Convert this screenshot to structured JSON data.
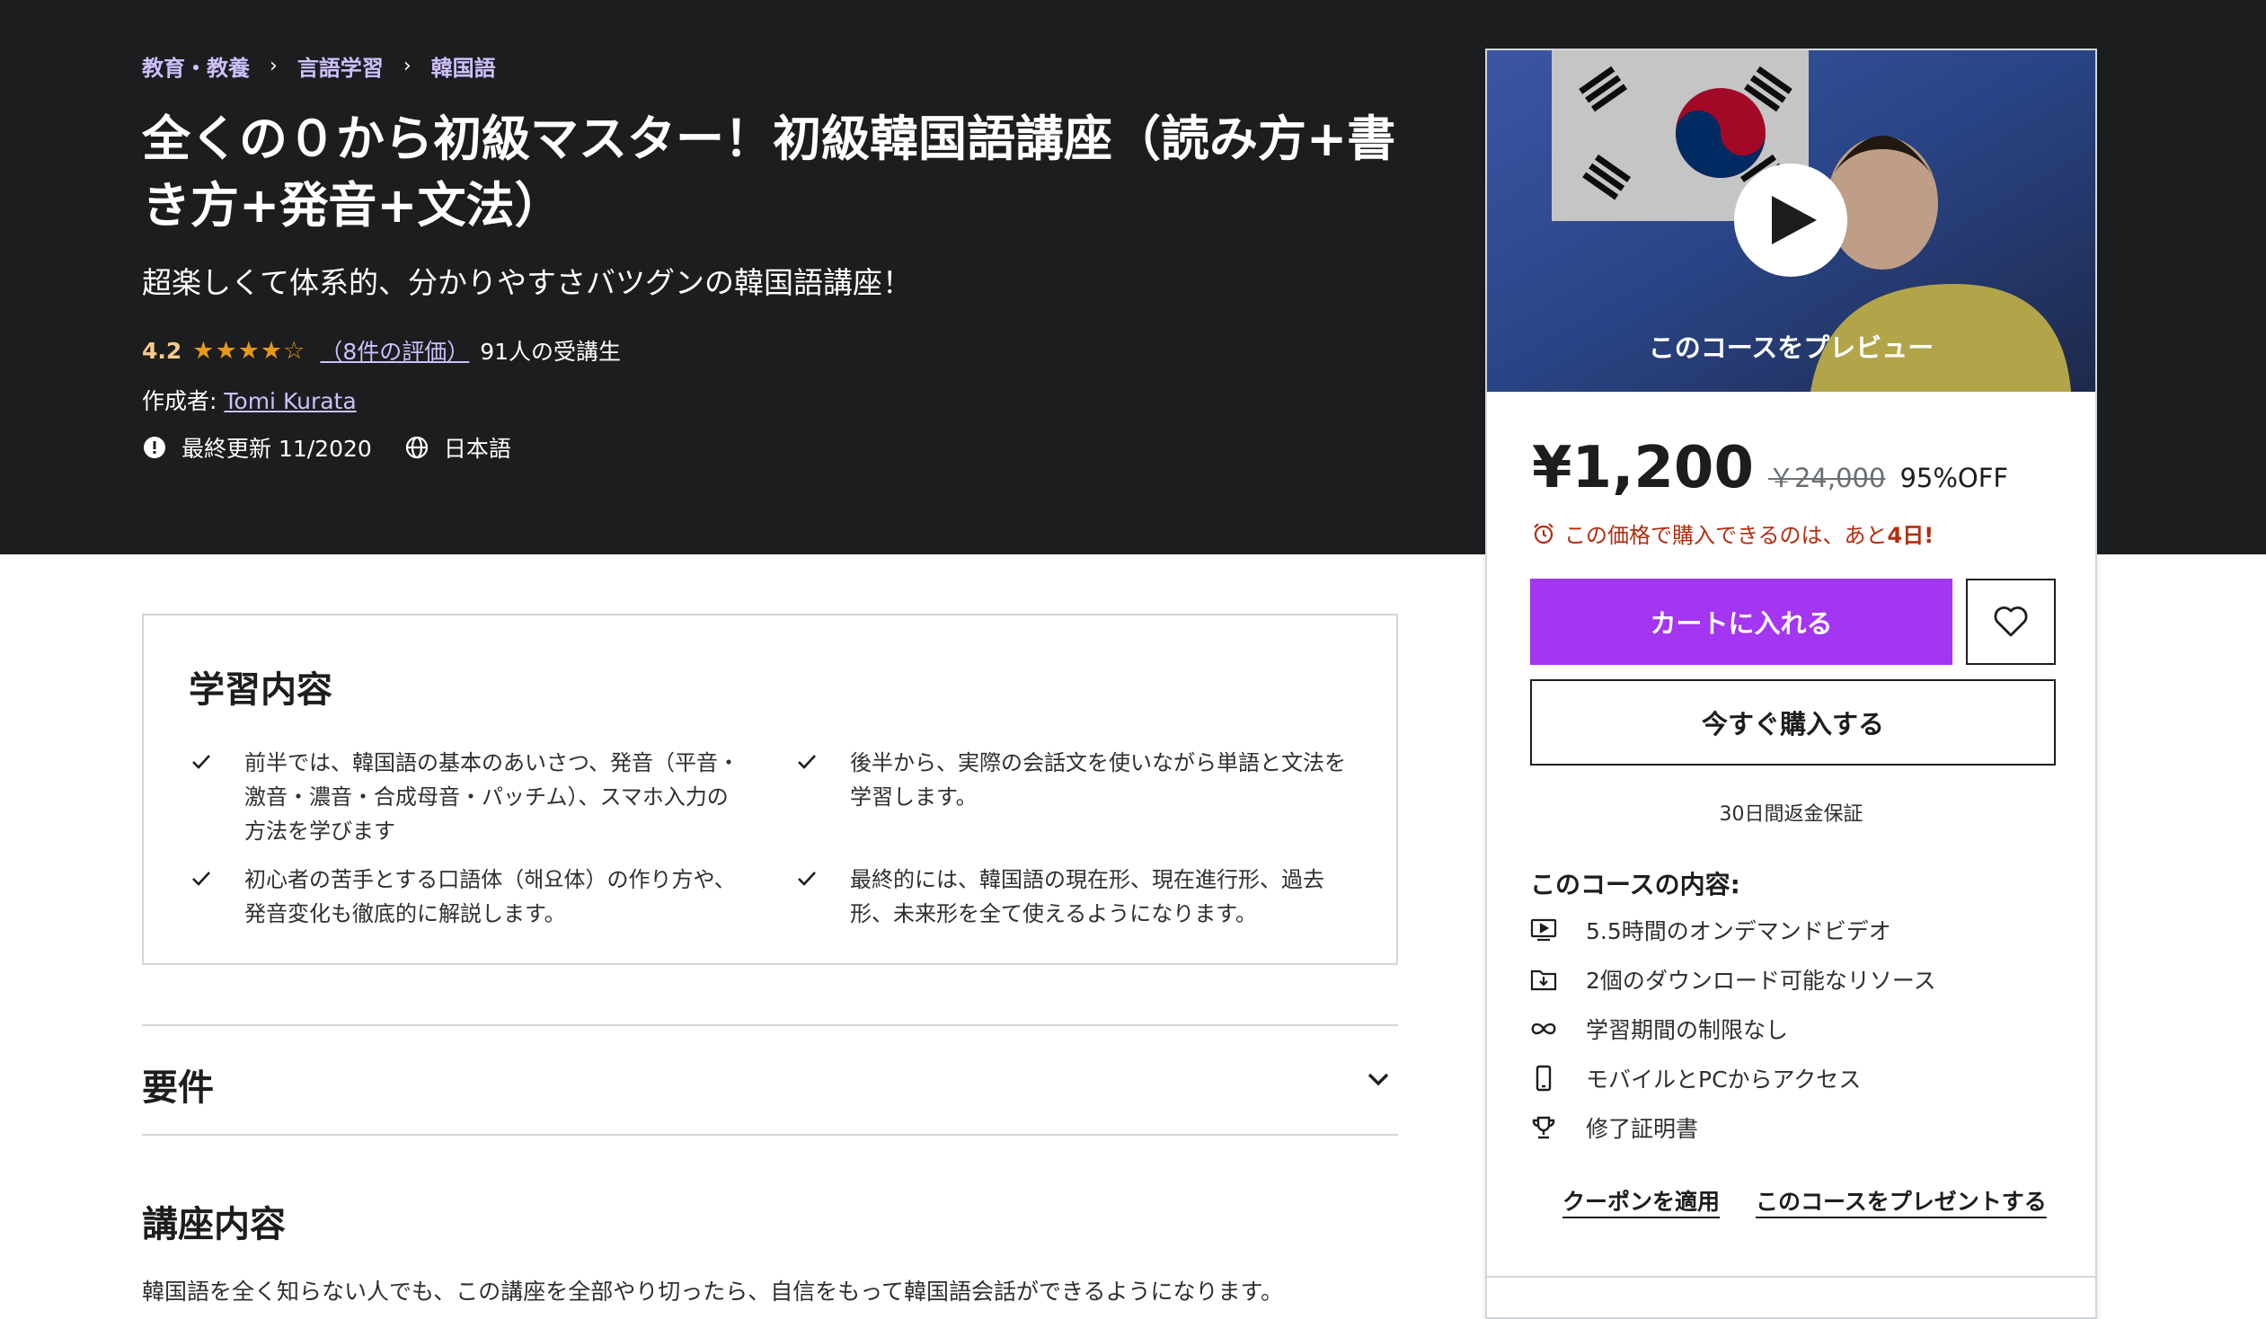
{
  "breadcrumb": [
    "教育・教養",
    "言語学習",
    "韓国語"
  ],
  "course": {
    "title": "全くの０から初級マスター！初級韓国語講座（読み方+書き方+発音+文法）",
    "subtitle": "超楽しくて体系的、分かりやすさバツグンの韓国語講座！",
    "rating": "4.2",
    "stars": "★★★★☆",
    "reviews": "（8件の評価）",
    "students": "91人の受講生",
    "author_prefix": "作成者:",
    "author": "Tomi Kurata",
    "updated": "最終更新 11/2020",
    "language": "日本語"
  },
  "learn": {
    "title": "学習内容",
    "items": [
      "前半では、韓国語の基本のあいさつ、発音（平音・激音・濃音・合成母音・パッチム）、スマホ入力の方法を学びます",
      "後半から、実際の会話文を使いながら単語と文法を学習します。",
      "初心者の苦手とする口語体（해요体）の作り方や、発音変化も徹底的に解説します。",
      "最終的には、韓国語の現在形、現在進行形、過去形、未来形を全て使えるようになります。"
    ]
  },
  "requirements": {
    "title": "要件"
  },
  "description": {
    "title": "講座内容",
    "text": "韓国語を全く知らない人でも、この講座を全部やり切ったら、自信をもって韓国語会話ができるようになります。"
  },
  "sidebar": {
    "preview_label": "このコースをプレビュー",
    "price": "¥1,200",
    "original_price": "￥24,000",
    "discount": "95%OFF",
    "timer_text": "この価格で購入できるのは、あと",
    "timer_days": "4日!",
    "cart_button": "カートに入れる",
    "buy_button": "今すぐ購入する",
    "guarantee": "30日間返金保証",
    "includes_title": "このコースの内容:",
    "includes": [
      {
        "icon": "video-icon",
        "text": "5.5時間のオンデマンドビデオ"
      },
      {
        "icon": "download-icon",
        "text": "2個のダウンロード可能なリソース"
      },
      {
        "icon": "infinity-icon",
        "text": "学習期間の制限なし"
      },
      {
        "icon": "mobile-icon",
        "text": "モバイルとPCからアクセス"
      },
      {
        "icon": "trophy-icon",
        "text": "修了証明書"
      }
    ],
    "coupon_link": "クーポンを適用",
    "gift_link": "このコースをプレゼントする"
  },
  "colors": {
    "hero_bg": "#1c1d1f",
    "accent_purple": "#a435f0",
    "link_purple": "#cec0fc",
    "rating_gold": "#e59819",
    "timer_red": "#b32d0f"
  }
}
